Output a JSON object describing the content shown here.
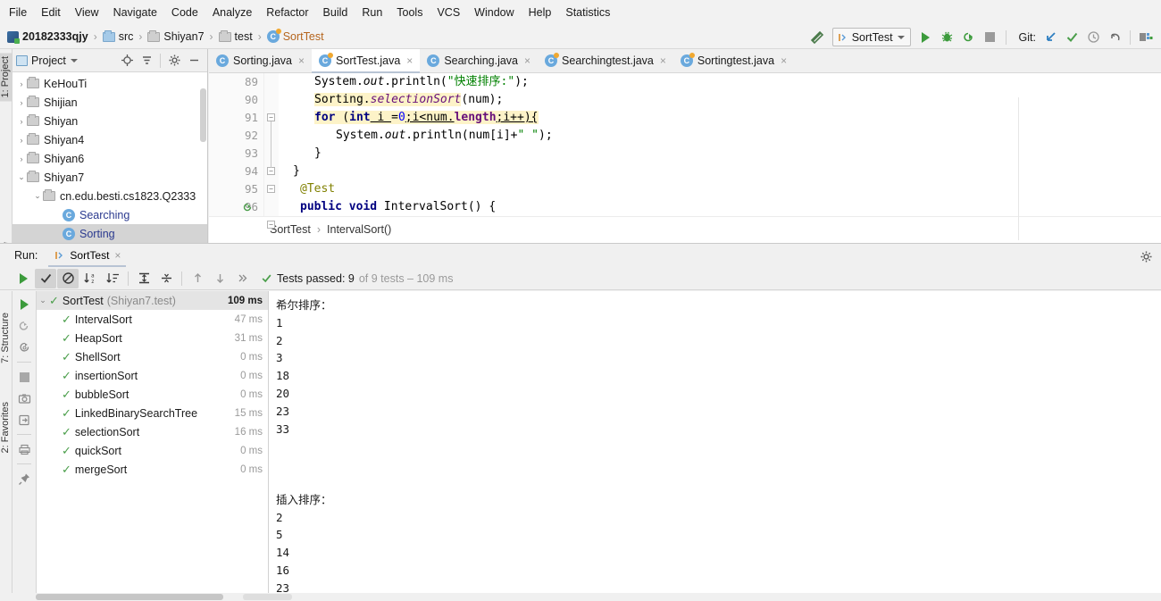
{
  "menubar": {
    "items": [
      "File",
      "Edit",
      "View",
      "Navigate",
      "Code",
      "Analyze",
      "Refactor",
      "Build",
      "Run",
      "Tools",
      "VCS",
      "Window",
      "Help",
      "Statistics"
    ]
  },
  "navbar": {
    "breadcrumbs": [
      {
        "label": "20182333qjy",
        "icon": "project-icon"
      },
      {
        "label": "src",
        "icon": "folder-icon"
      },
      {
        "label": "Shiyan7",
        "icon": "folder-icon"
      },
      {
        "label": "test",
        "icon": "folder-icon"
      },
      {
        "label": "SortTest",
        "icon": "class-test-icon"
      }
    ],
    "separator": "›",
    "hammer_icon": "build-hammer-icon",
    "run_config": {
      "label": "SortTest",
      "config_icon": "run-config-icon",
      "chevron": "chevron-down-icon"
    },
    "buttons": [
      {
        "name": "run-button",
        "icon": "play-icon"
      },
      {
        "name": "debug-button",
        "icon": "bug-icon"
      },
      {
        "name": "run-with-coverage-button",
        "icon": "coverage-icon"
      },
      {
        "name": "stop-button",
        "icon": "stop-icon"
      }
    ],
    "git": {
      "label": "Git:",
      "buttons": [
        {
          "name": "git-update-button",
          "icon": "arrow-down-left-icon"
        },
        {
          "name": "git-commit-button",
          "icon": "check-icon"
        },
        {
          "name": "git-history-button",
          "icon": "clock-icon"
        },
        {
          "name": "git-rollback-button",
          "icon": "undo-icon"
        }
      ]
    },
    "search_everywhere_icon": "search-everywhere-icon"
  },
  "left_strip": {
    "labels": [
      {
        "text": "1: Project",
        "active": true
      },
      {
        "text": "7: Structure",
        "active": false
      },
      {
        "text": "2: Favorites",
        "active": false
      }
    ]
  },
  "project_panel": {
    "title": "Project",
    "chevron": "chevron-down-icon",
    "toolbar": [
      {
        "name": "locate-icon"
      },
      {
        "name": "collapse-all-icon"
      },
      {
        "name": "settings-gear-icon"
      },
      {
        "name": "hide-icon"
      }
    ],
    "tree": [
      {
        "label": "KeHouTi",
        "indent": 0,
        "arrow": "›",
        "type": "folder",
        "selected": false
      },
      {
        "label": "Shijian",
        "indent": 0,
        "arrow": "›",
        "type": "folder",
        "selected": false
      },
      {
        "label": "Shiyan",
        "indent": 0,
        "arrow": "›",
        "type": "folder",
        "selected": false
      },
      {
        "label": "Shiyan4",
        "indent": 0,
        "arrow": "›",
        "type": "folder",
        "selected": false
      },
      {
        "label": "Shiyan6",
        "indent": 0,
        "arrow": "›",
        "type": "folder",
        "selected": false
      },
      {
        "label": "Shiyan7",
        "indent": 0,
        "arrow": "⌄",
        "type": "folder",
        "selected": false
      },
      {
        "label": "cn.edu.besti.cs1823.Q2333",
        "indent": 1,
        "arrow": "⌄",
        "type": "folder",
        "selected": false
      },
      {
        "label": "Searching",
        "indent": 2,
        "arrow": "",
        "type": "class",
        "selected": false
      },
      {
        "label": "Sorting",
        "indent": 2,
        "arrow": "",
        "type": "class",
        "selected": true
      }
    ]
  },
  "editor": {
    "tabs": [
      {
        "label": "Sorting.java",
        "icon": "class-icon",
        "active": false
      },
      {
        "label": "SortTest.java",
        "icon": "class-test-icon",
        "active": true
      },
      {
        "label": "Searching.java",
        "icon": "class-icon",
        "active": false
      },
      {
        "label": "Searchingtest.java",
        "icon": "class-test-icon",
        "active": false
      },
      {
        "label": "Sortingtest.java",
        "icon": "class-test-icon",
        "active": false
      }
    ],
    "close_glyph": "×",
    "lines": [
      {
        "number": "89",
        "fold": "",
        "gutter_icon": ""
      },
      {
        "number": "90",
        "fold": "",
        "gutter_icon": ""
      },
      {
        "number": "91",
        "fold": "open",
        "gutter_icon": ""
      },
      {
        "number": "92",
        "fold": "",
        "gutter_icon": ""
      },
      {
        "number": "93",
        "fold": "close",
        "gutter_icon": ""
      },
      {
        "number": "94",
        "fold": "close",
        "gutter_icon": ""
      },
      {
        "number": "95",
        "fold": "",
        "gutter_icon": ""
      },
      {
        "number": "96",
        "fold": "open",
        "gutter_icon": "run-test-icon"
      }
    ],
    "code": {
      "line89_1": "System.",
      "line89_2": "out",
      "line89_3": ".println(",
      "line89_4": "\"快速排序:\"",
      "line89_5": ");",
      "line90_1": "Sorting.",
      "line90_2": "selectionSort",
      "line90_3": "(num);",
      "line91_1": "for",
      "line91_2": " (",
      "line91_3": "int",
      "line91_4": " i ",
      "line91_5": "=",
      "line91_6": "0",
      "line91_7": ";i<num.",
      "line91_8": "length",
      "line91_9": ";i++){",
      "line92_1": "System.",
      "line92_2": "out",
      "line92_3": ".println(num[i]+",
      "line92_4": "\" \"",
      "line92_5": ");",
      "line93_1": "}",
      "line94_1": "}",
      "line95_1": "@Test",
      "line96_1": "public void",
      "line96_2": " IntervalSort() {"
    },
    "breadcrumb": {
      "items": [
        "SortTest",
        "IntervalSort()"
      ],
      "separator": "›"
    }
  },
  "run_window": {
    "label": "Run:",
    "tab": {
      "label": "SortTest",
      "icon": "run-config-icon",
      "close": "×"
    },
    "gear_icon": "settings-gear-icon",
    "toolbar": [
      {
        "name": "rerun-button",
        "icon": "play-icon",
        "pressed": false
      },
      {
        "name": "show-passed-toggle",
        "icon": "check-icon",
        "pressed": true
      },
      {
        "name": "show-ignored-toggle",
        "icon": "no-entry-icon",
        "pressed": true
      },
      {
        "name": "sort-alphabetically-button",
        "icon": "sort-alpha-icon",
        "pressed": false
      },
      {
        "name": "sort-by-duration-button",
        "icon": "sort-duration-icon",
        "pressed": false
      },
      {
        "name": "expand-all-button",
        "icon": "expand-all-icon",
        "pressed": false
      },
      {
        "name": "collapse-all-button",
        "icon": "collapse-all-icon",
        "pressed": false
      },
      {
        "name": "prev-failed-button",
        "icon": "arrow-up-icon",
        "pressed": false
      },
      {
        "name": "next-failed-button",
        "icon": "arrow-down-icon",
        "pressed": false
      },
      {
        "name": "more-options-button",
        "icon": "chevron-double-right-icon",
        "pressed": false
      }
    ],
    "status": {
      "check_icon": "check-icon",
      "main": "Tests passed: 9",
      "dim": "of 9 tests – 109 ms"
    },
    "vtools": [
      {
        "name": "rerun-tests-button",
        "icon": "play-icon"
      },
      {
        "name": "rerun-failed-button",
        "icon": "rerun-failed-icon"
      },
      {
        "name": "toggle-auto-test-button",
        "icon": "auto-test-icon"
      },
      {
        "name": "stop-button",
        "icon": "stop-icon"
      },
      {
        "name": "screenshot-button",
        "icon": "camera-icon"
      },
      {
        "name": "export-button",
        "icon": "export-icon"
      },
      {
        "name": "print-button",
        "icon": "print-icon"
      },
      {
        "name": "pin-tab-button",
        "icon": "pin-icon"
      }
    ],
    "test_tree": {
      "root": {
        "name": "SortTest",
        "package": "(Shiyan7.test)",
        "time": "109 ms",
        "status": "passed",
        "arrow": "⌄"
      },
      "tests": [
        {
          "name": "IntervalSort",
          "time": "47 ms",
          "status": "passed"
        },
        {
          "name": "HeapSort",
          "time": "31 ms",
          "status": "passed"
        },
        {
          "name": "ShellSort",
          "time": "0 ms",
          "status": "passed"
        },
        {
          "name": "insertionSort",
          "time": "0 ms",
          "status": "passed"
        },
        {
          "name": "bubbleSort",
          "time": "0 ms",
          "status": "passed"
        },
        {
          "name": "LinkedBinarySearchTree",
          "time": "15 ms",
          "status": "passed"
        },
        {
          "name": "selectionSort",
          "time": "16 ms",
          "status": "passed"
        },
        {
          "name": "quickSort",
          "time": "0 ms",
          "status": "passed"
        },
        {
          "name": "mergeSort",
          "time": "0 ms",
          "status": "passed"
        }
      ]
    },
    "console": {
      "lines": [
        "希尔排序：",
        "1",
        "2",
        "3",
        "18",
        "20",
        "23",
        "33",
        "",
        "",
        "",
        "插入排序：",
        "2",
        "5",
        "14",
        "16",
        "23"
      ]
    }
  },
  "colors": {
    "accent_green": "#4a9e4a",
    "keyword_blue": "#000080",
    "string_green": "#008000",
    "number_blue": "#0000ff",
    "field_purple": "#660e7a",
    "annotation_olive": "#808000",
    "highlight_yellow": "#fdf3c8",
    "class_orange": "#b5651d",
    "panel_grey": "#f0f0f0",
    "selection_grey": "#d4d4d4"
  }
}
